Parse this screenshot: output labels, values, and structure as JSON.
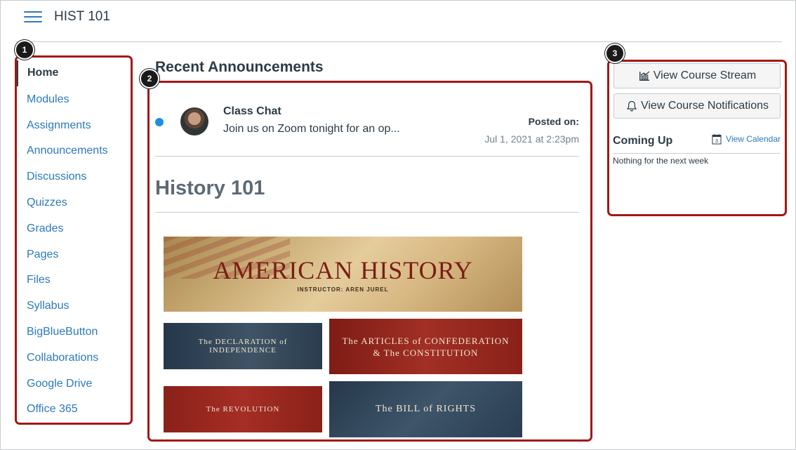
{
  "header": {
    "course_title": "HIST 101"
  },
  "callouts": [
    "1",
    "2",
    "3"
  ],
  "nav": {
    "items": [
      {
        "label": "Home",
        "active": true
      },
      {
        "label": "Modules"
      },
      {
        "label": "Assignments"
      },
      {
        "label": "Announcements"
      },
      {
        "label": "Discussions"
      },
      {
        "label": "Quizzes"
      },
      {
        "label": "Grades"
      },
      {
        "label": "Pages"
      },
      {
        "label": "Files"
      },
      {
        "label": "Syllabus"
      },
      {
        "label": "BigBlueButton"
      },
      {
        "label": "Collaborations"
      },
      {
        "label": "Google Drive"
      },
      {
        "label": "Office 365"
      }
    ]
  },
  "main": {
    "section_title": "Recent Announcements",
    "announcement": {
      "title": "Class Chat",
      "snippet": "Join us on Zoom tonight for an op...",
      "posted_label": "Posted on:",
      "posted_date": "Jul 1, 2021 at 2:23pm"
    },
    "page_title": "History 101",
    "banners": {
      "main_title": "AMERICAN HISTORY",
      "main_subtitle": "INSTRUCTOR: AREN JUREL",
      "declaration": "The DECLARATION of INDEPENDENCE",
      "articles_line1": "The ARTICLES of CONFEDERATION",
      "articles_line2": "& The CONSTITUTION",
      "revolution": "The REVOLUTION",
      "bill": "The BILL of RIGHTS"
    }
  },
  "sidebar": {
    "stream_label": "View Course Stream",
    "notifications_label": "View Course Notifications",
    "coming_up_title": "Coming Up",
    "calendar_link": "View Calendar",
    "calendar_icon_day": "3",
    "empty_text": "Nothing for the next week"
  },
  "colors": {
    "link": "#2b7abc",
    "callout": "#a01919",
    "unread": "#1a8fe3",
    "text": "#2d3b45"
  }
}
